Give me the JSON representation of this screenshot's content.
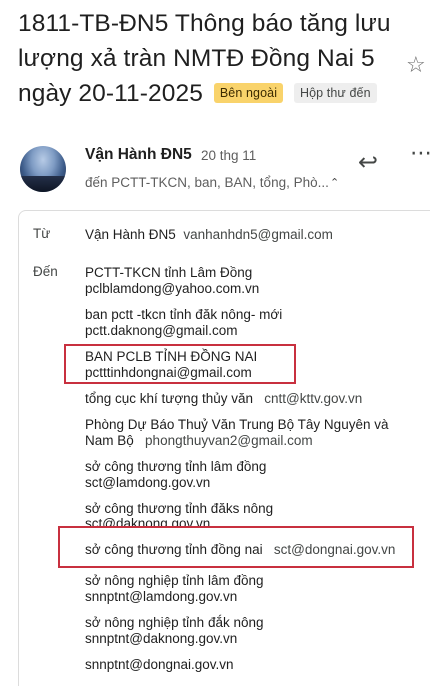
{
  "email": {
    "subject": "1811-TB-ĐN5 Thông báo tăng lưu lượng xả tràn NMTĐ Đồng Nai 5 ngày 20-11-2025",
    "badges": {
      "external": "Bên ngoài",
      "inbox": "Hộp thư đến"
    },
    "sender_name": "Vận Hành ĐN5",
    "date": "20 thg 11",
    "to_summary": "đến PCTT-TKCN, ban, BAN, tổng, Phò...",
    "icons": [
      "star-icon",
      "reply-icon",
      "more-icon",
      "chevron-up-icon",
      "avatar"
    ]
  },
  "details": {
    "from_label": "Từ",
    "from_name": "Vận Hành ĐN5",
    "from_email": "vanhanhdn5@gmail.com",
    "to_label": "Đến",
    "recipients": {
      "r1_name": "PCTT-TKCN tỉnh Lâm Đồng",
      "r1_email": "pclblamdong@yahoo.com.vn",
      "r2_name": "ban pctt -tkcn tỉnh đăk nông- mới",
      "r2_email": "pctt.daknong@gmail.com",
      "r3_name": "BAN PCLB TỈNH ĐỒNG NAI",
      "r3_email": "pctttinhdongnai@gmail.com",
      "r4_name": "tổng cục khí tượng thủy văn",
      "r4_email": "cntt@kttv.gov.vn",
      "r5_name_line1": "Phòng Dự Báo Thuỷ Văn Trung Bộ Tây Nguyên và",
      "r5_name_line2": "Nam Bộ",
      "r5_email": "phongthuyvan2@gmail.com",
      "r6_name": "sở công thương tỉnh lâm đồng",
      "r6_email": "sct@lamdong.gov.vn",
      "r7_name": "sở công thương tỉnh đăks nông",
      "r7_email": "sct@daknong.gov.vn",
      "r8_name": "sở công thương tỉnh đồng nai",
      "r8_email": "sct@dongnai.gov.vn",
      "r9_name": "sở nông nghiệp tỉnh lâm đồng",
      "r9_email": "snnptnt@lamdong.gov.vn",
      "r10_name": "sở nông nghiệp tỉnh đắk nông",
      "r10_email": "snnptnt@daknong.gov.vn",
      "r11_email": "snnptnt@dongnai.gov.vn"
    }
  },
  "colors": {
    "highlight": "#c8303f",
    "external_badge": "#f9d36b"
  }
}
